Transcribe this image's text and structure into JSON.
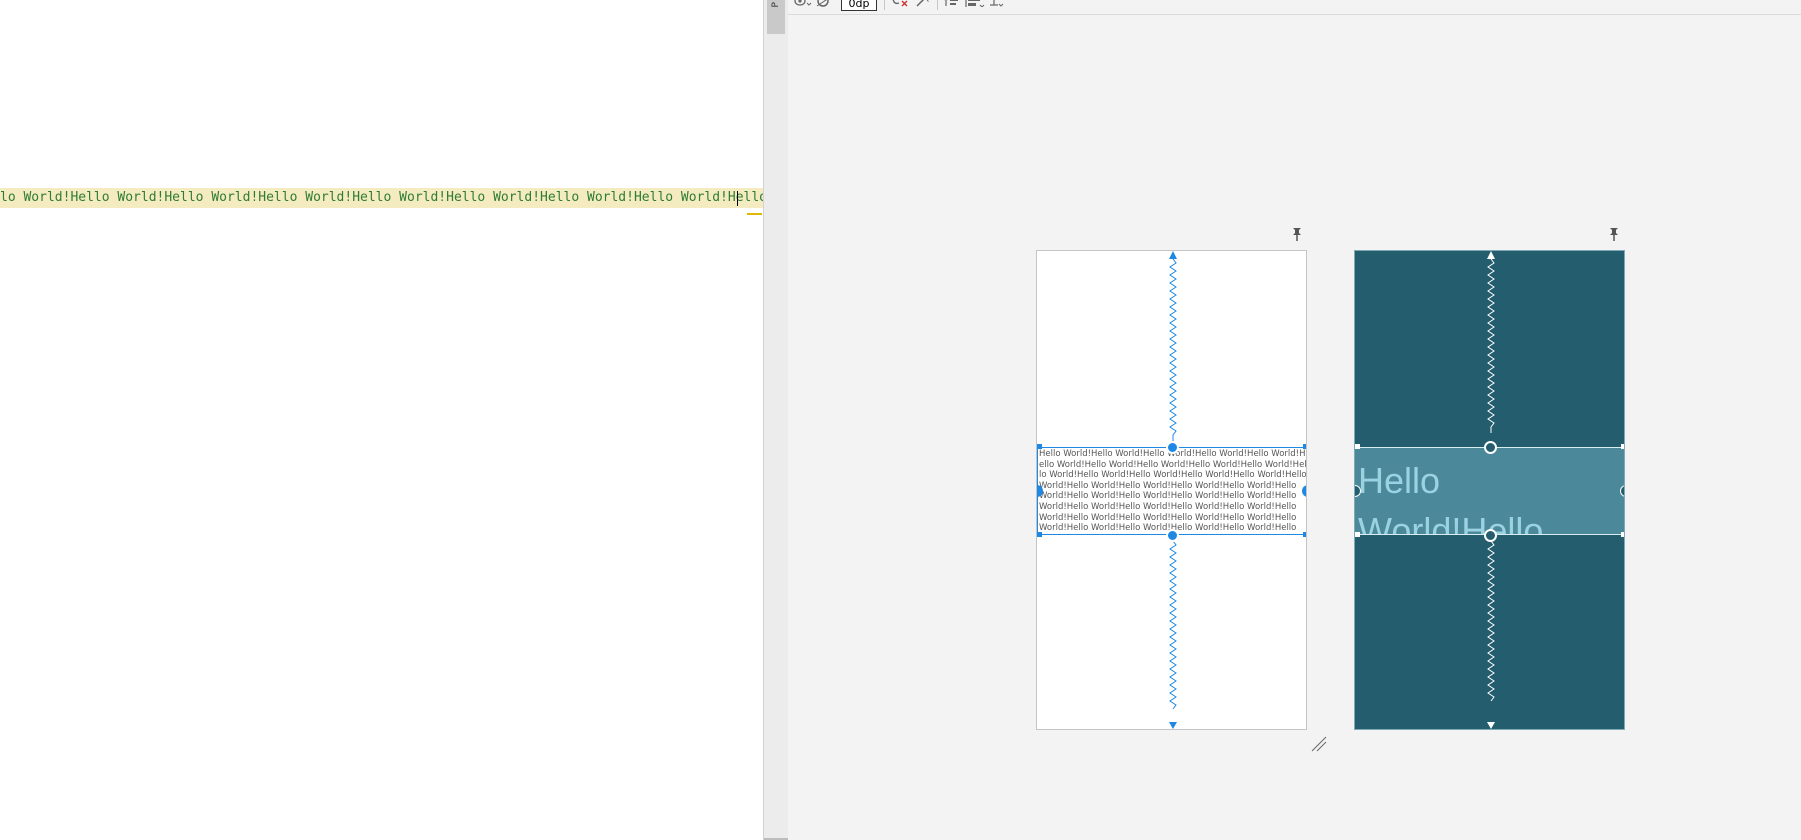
{
  "editor": {
    "code_line": "lo World!Hello World!Hello World!Hello World!Hello World!Hello World!Hello World!Hello World!Hello World!Hel"
  },
  "side_panel": {
    "tab_label": "P"
  },
  "toolbar": {
    "margin_value": "0dp",
    "icons": [
      "eye-icon",
      "magnet-icon",
      "clear-constraints-icon",
      "infer-constraints-icon",
      "pack-icon",
      "align-icon",
      "guidelines-icon"
    ]
  },
  "design_view": {
    "text_content": "Hello World!Hello World!Hello World!Hello World!Hello World!Hello World!Hello World!Hello World!Hello World!Hello World!Hello World!Hello World!Hello World!Hello World!Hello World!Hello World!Hello World!Hello World!Hello World!Hello World!Hello World!Hello World!Hello World!Hello World!Hello World!Hello World!Hello World!Hello World!Hello World!Hello World!Hello World!Hello World!Hello World!Hello World!Hello World!Hello World!Hello World!Hello World!Hello World!Hello World!Hello World!Hello World!Hello World!Hello World!Hello World!Hello World!Hello World!Hello World!Hello World!Hello World!Hello World!Hello World!Hello World!Hello World!Hello World!Hello World!Hello World!Hello World!Hello World!Hello World!Hello World!Hello World!Hello World!Hello World!Hello World!Hello World!Hello World!Hello World!Hello World!Hello World!Hello World!Hello World!Hello World!Hello World!Hello World!Hello World!Hello World!Hello World!"
  },
  "blueprint_view": {
    "text_content": "Hello World!Hello"
  },
  "colors": {
    "accent": "#1e88e5",
    "blueprint_bg": "#235d6e",
    "blueprint_widget": "#4b8899",
    "code_highlight": "#f5ebc0",
    "code_text": "#2e7d32"
  }
}
